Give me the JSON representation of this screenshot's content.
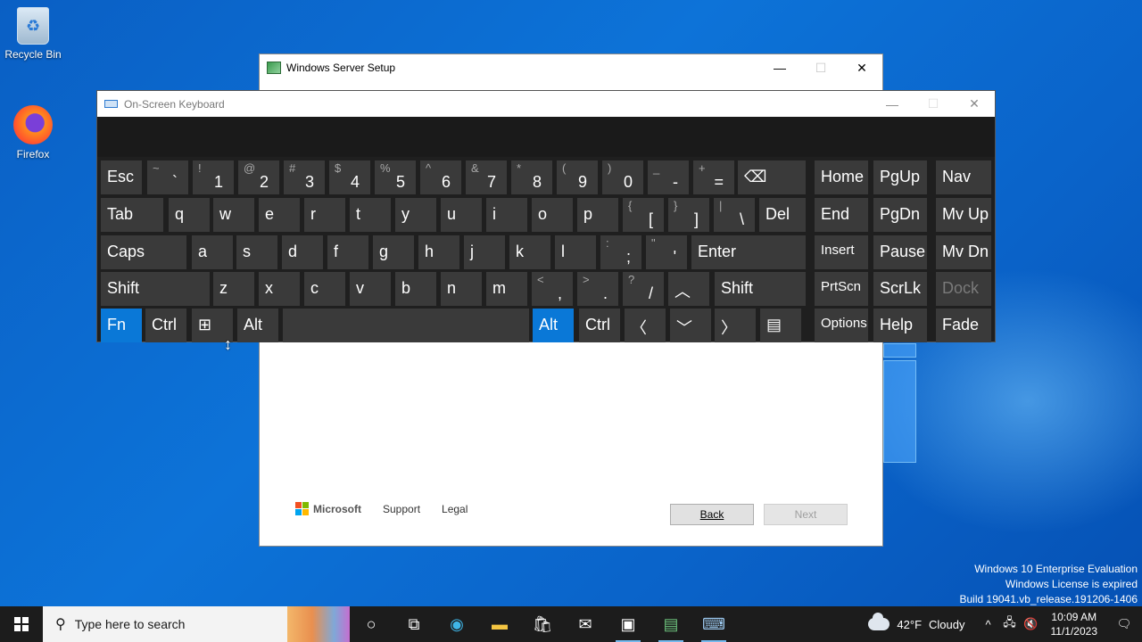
{
  "desktop": {
    "icons": [
      {
        "label": "Recycle Bin",
        "icon": "recycle-bin-icon"
      },
      {
        "label": "Firefox",
        "icon": "firefox-icon"
      }
    ],
    "watermark": {
      "line1": "Windows 10 Enterprise Evaluation",
      "line2": "Windows License is expired",
      "line3": "Build 19041.vb_release.191206-1406"
    }
  },
  "setup_window": {
    "title": "Windows Server Setup",
    "footer": {
      "brand": "Microsoft",
      "support": "Support",
      "legal": "Legal",
      "back_label": "Back",
      "next_label": "Next"
    }
  },
  "osk": {
    "title": "On-Screen Keyboard",
    "keys": [
      {
        "main": "Esc"
      },
      {
        "sym": "~",
        "lo": "`"
      },
      {
        "sym": "!",
        "lo": "1"
      },
      {
        "sym": "@",
        "lo": "2"
      },
      {
        "sym": "#",
        "lo": "3"
      },
      {
        "sym": "$",
        "lo": "4"
      },
      {
        "sym": "%",
        "lo": "5"
      },
      {
        "sym": "^",
        "lo": "6"
      },
      {
        "sym": "&",
        "lo": "7"
      },
      {
        "sym": "*",
        "lo": "8"
      },
      {
        "sym": "(",
        "lo": "9"
      },
      {
        "sym": ")",
        "lo": "0"
      },
      {
        "sym": "_",
        "lo": "-"
      },
      {
        "sym": "+",
        "lo": "="
      },
      {
        "main": "⌫"
      },
      {
        "main": "Home"
      },
      {
        "main": "PgUp"
      },
      {
        "main": "Nav"
      },
      {
        "main": "Tab"
      },
      {
        "main": "q"
      },
      {
        "main": "w"
      },
      {
        "main": "e"
      },
      {
        "main": "r"
      },
      {
        "main": "t"
      },
      {
        "main": "y"
      },
      {
        "main": "u"
      },
      {
        "main": "i"
      },
      {
        "main": "o"
      },
      {
        "main": "p"
      },
      {
        "sym": "{",
        "lo": "["
      },
      {
        "sym": "}",
        "lo": "]"
      },
      {
        "sym": "|",
        "lo": "\\"
      },
      {
        "main": "Del"
      },
      {
        "main": "End"
      },
      {
        "main": "PgDn"
      },
      {
        "main": "Mv Up"
      },
      {
        "main": "Caps"
      },
      {
        "main": "a"
      },
      {
        "main": "s"
      },
      {
        "main": "d"
      },
      {
        "main": "f"
      },
      {
        "main": "g"
      },
      {
        "main": "h"
      },
      {
        "main": "j"
      },
      {
        "main": "k"
      },
      {
        "main": "l"
      },
      {
        "sym": ":",
        "lo": ";"
      },
      {
        "sym": "\"",
        "lo": "'"
      },
      {
        "main": "Enter"
      },
      {
        "main": "Insert"
      },
      {
        "main": "Pause"
      },
      {
        "main": "Mv Dn"
      },
      {
        "main": "Shift"
      },
      {
        "main": "z"
      },
      {
        "main": "x"
      },
      {
        "main": "c"
      },
      {
        "main": "v"
      },
      {
        "main": "b"
      },
      {
        "main": "n"
      },
      {
        "main": "m"
      },
      {
        "sym": "<",
        "lo": ","
      },
      {
        "sym": ">",
        "lo": "."
      },
      {
        "sym": "?",
        "lo": "/"
      },
      {
        "main": "︿"
      },
      {
        "main": "Shift"
      },
      {
        "main": "PrtScn"
      },
      {
        "main": "ScrLk"
      },
      {
        "main": "Dock"
      },
      {
        "main": "Fn"
      },
      {
        "main": "Ctrl"
      },
      {
        "main": "⊞"
      },
      {
        "main": "Alt"
      },
      {
        "main": ""
      },
      {
        "main": "Alt"
      },
      {
        "main": "Ctrl"
      },
      {
        "main": "〈"
      },
      {
        "main": "﹀"
      },
      {
        "main": "〉"
      },
      {
        "main": "▤"
      },
      {
        "main": "Options"
      },
      {
        "main": "Help"
      },
      {
        "main": "Fade"
      }
    ]
  },
  "taskbar": {
    "search_placeholder": "Type here to search",
    "weather": {
      "temp": "42°F",
      "condition": "Cloudy"
    },
    "clock": {
      "time": "10:09 AM",
      "date": "11/1/2023"
    }
  }
}
